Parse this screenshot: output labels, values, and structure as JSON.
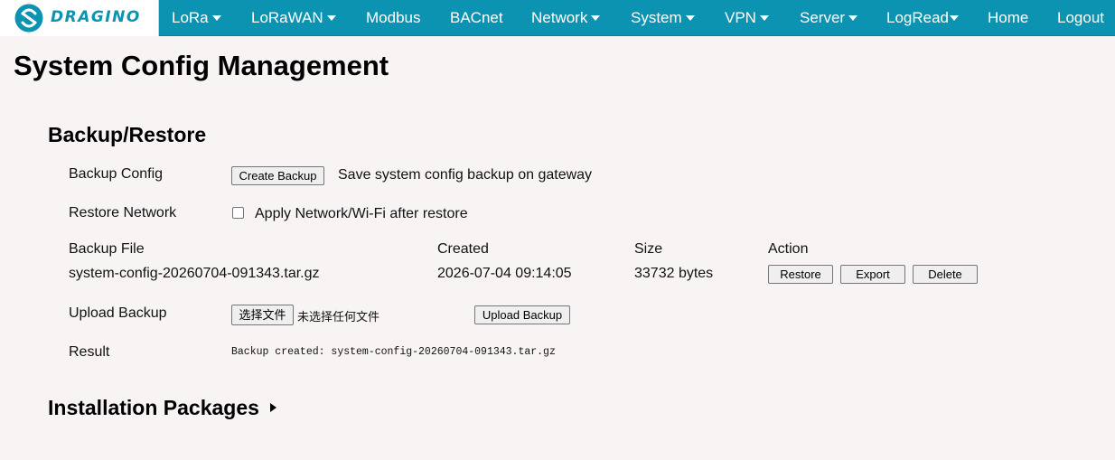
{
  "brand": {
    "logo_text": "DRAGINO",
    "accent_color": "#0c93b2"
  },
  "nav": {
    "items": [
      {
        "label": "LoRa",
        "dropdown": true
      },
      {
        "label": "LoRaWAN",
        "dropdown": true
      },
      {
        "label": "Modbus",
        "dropdown": false
      },
      {
        "label": "BACnet",
        "dropdown": false
      },
      {
        "label": "Network",
        "dropdown": true
      },
      {
        "label": "System",
        "dropdown": true
      },
      {
        "label": "VPN",
        "dropdown": true
      },
      {
        "label": "Server",
        "dropdown": true
      },
      {
        "label": "LogRead",
        "dropdown": true
      },
      {
        "label": "Home",
        "dropdown": false
      },
      {
        "label": "Logout",
        "dropdown": false
      }
    ]
  },
  "page": {
    "title": "System Config Management"
  },
  "backup_restore": {
    "title": "Backup/Restore",
    "backup_config": {
      "label": "Backup Config",
      "button": "Create Backup",
      "description": "Save system config backup on gateway"
    },
    "restore_network": {
      "label": "Restore Network",
      "checkbox_label": "Apply Network/Wi-Fi after restore",
      "checked": false
    },
    "table": {
      "headers": {
        "file": "Backup File",
        "created": "Created",
        "size": "Size",
        "action": "Action"
      },
      "rows": [
        {
          "file": "system-config-20260704-091343.tar.gz",
          "created": "2026-07-04 09:14:05",
          "size": "33732 bytes",
          "restore": "Restore",
          "export": "Export",
          "delete": "Delete"
        }
      ]
    },
    "upload": {
      "label": "Upload Backup",
      "choose_button": "选择文件",
      "no_file_text": "未选择任何文件",
      "upload_button": "Upload Backup"
    },
    "result": {
      "label": "Result",
      "text": "Backup created: system-config-20260704-091343.tar.gz"
    }
  },
  "installation_packages": {
    "title": "Installation Packages"
  }
}
